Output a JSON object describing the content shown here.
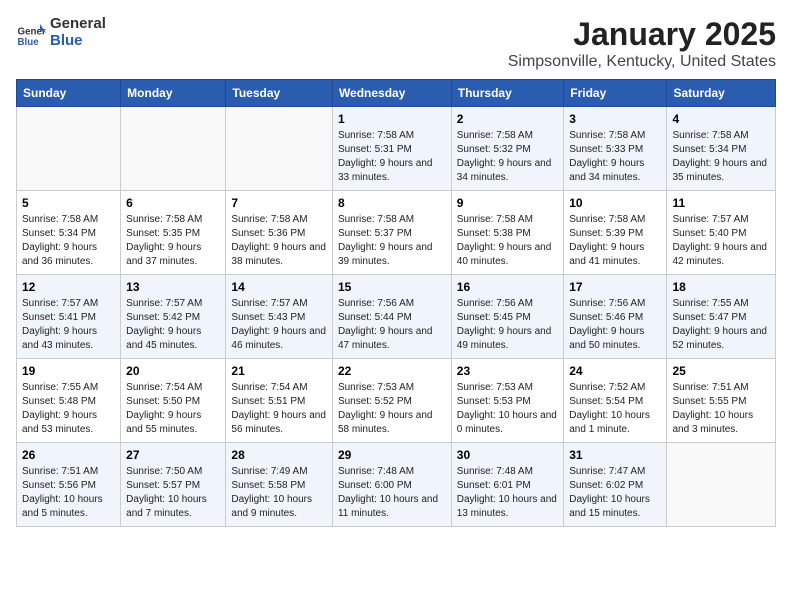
{
  "logo": {
    "name_general": "General",
    "name_blue": "Blue"
  },
  "header": {
    "title": "January 2025",
    "subtitle": "Simpsonville, Kentucky, United States"
  },
  "weekdays": [
    "Sunday",
    "Monday",
    "Tuesday",
    "Wednesday",
    "Thursday",
    "Friday",
    "Saturday"
  ],
  "weeks": [
    [
      {
        "day": "",
        "sunrise": "",
        "sunset": "",
        "daylight": ""
      },
      {
        "day": "",
        "sunrise": "",
        "sunset": "",
        "daylight": ""
      },
      {
        "day": "",
        "sunrise": "",
        "sunset": "",
        "daylight": ""
      },
      {
        "day": "1",
        "sunrise": "Sunrise: 7:58 AM",
        "sunset": "Sunset: 5:31 PM",
        "daylight": "Daylight: 9 hours and 33 minutes."
      },
      {
        "day": "2",
        "sunrise": "Sunrise: 7:58 AM",
        "sunset": "Sunset: 5:32 PM",
        "daylight": "Daylight: 9 hours and 34 minutes."
      },
      {
        "day": "3",
        "sunrise": "Sunrise: 7:58 AM",
        "sunset": "Sunset: 5:33 PM",
        "daylight": "Daylight: 9 hours and 34 minutes."
      },
      {
        "day": "4",
        "sunrise": "Sunrise: 7:58 AM",
        "sunset": "Sunset: 5:34 PM",
        "daylight": "Daylight: 9 hours and 35 minutes."
      }
    ],
    [
      {
        "day": "5",
        "sunrise": "Sunrise: 7:58 AM",
        "sunset": "Sunset: 5:34 PM",
        "daylight": "Daylight: 9 hours and 36 minutes."
      },
      {
        "day": "6",
        "sunrise": "Sunrise: 7:58 AM",
        "sunset": "Sunset: 5:35 PM",
        "daylight": "Daylight: 9 hours and 37 minutes."
      },
      {
        "day": "7",
        "sunrise": "Sunrise: 7:58 AM",
        "sunset": "Sunset: 5:36 PM",
        "daylight": "Daylight: 9 hours and 38 minutes."
      },
      {
        "day": "8",
        "sunrise": "Sunrise: 7:58 AM",
        "sunset": "Sunset: 5:37 PM",
        "daylight": "Daylight: 9 hours and 39 minutes."
      },
      {
        "day": "9",
        "sunrise": "Sunrise: 7:58 AM",
        "sunset": "Sunset: 5:38 PM",
        "daylight": "Daylight: 9 hours and 40 minutes."
      },
      {
        "day": "10",
        "sunrise": "Sunrise: 7:58 AM",
        "sunset": "Sunset: 5:39 PM",
        "daylight": "Daylight: 9 hours and 41 minutes."
      },
      {
        "day": "11",
        "sunrise": "Sunrise: 7:57 AM",
        "sunset": "Sunset: 5:40 PM",
        "daylight": "Daylight: 9 hours and 42 minutes."
      }
    ],
    [
      {
        "day": "12",
        "sunrise": "Sunrise: 7:57 AM",
        "sunset": "Sunset: 5:41 PM",
        "daylight": "Daylight: 9 hours and 43 minutes."
      },
      {
        "day": "13",
        "sunrise": "Sunrise: 7:57 AM",
        "sunset": "Sunset: 5:42 PM",
        "daylight": "Daylight: 9 hours and 45 minutes."
      },
      {
        "day": "14",
        "sunrise": "Sunrise: 7:57 AM",
        "sunset": "Sunset: 5:43 PM",
        "daylight": "Daylight: 9 hours and 46 minutes."
      },
      {
        "day": "15",
        "sunrise": "Sunrise: 7:56 AM",
        "sunset": "Sunset: 5:44 PM",
        "daylight": "Daylight: 9 hours and 47 minutes."
      },
      {
        "day": "16",
        "sunrise": "Sunrise: 7:56 AM",
        "sunset": "Sunset: 5:45 PM",
        "daylight": "Daylight: 9 hours and 49 minutes."
      },
      {
        "day": "17",
        "sunrise": "Sunrise: 7:56 AM",
        "sunset": "Sunset: 5:46 PM",
        "daylight": "Daylight: 9 hours and 50 minutes."
      },
      {
        "day": "18",
        "sunrise": "Sunrise: 7:55 AM",
        "sunset": "Sunset: 5:47 PM",
        "daylight": "Daylight: 9 hours and 52 minutes."
      }
    ],
    [
      {
        "day": "19",
        "sunrise": "Sunrise: 7:55 AM",
        "sunset": "Sunset: 5:48 PM",
        "daylight": "Daylight: 9 hours and 53 minutes."
      },
      {
        "day": "20",
        "sunrise": "Sunrise: 7:54 AM",
        "sunset": "Sunset: 5:50 PM",
        "daylight": "Daylight: 9 hours and 55 minutes."
      },
      {
        "day": "21",
        "sunrise": "Sunrise: 7:54 AM",
        "sunset": "Sunset: 5:51 PM",
        "daylight": "Daylight: 9 hours and 56 minutes."
      },
      {
        "day": "22",
        "sunrise": "Sunrise: 7:53 AM",
        "sunset": "Sunset: 5:52 PM",
        "daylight": "Daylight: 9 hours and 58 minutes."
      },
      {
        "day": "23",
        "sunrise": "Sunrise: 7:53 AM",
        "sunset": "Sunset: 5:53 PM",
        "daylight": "Daylight: 10 hours and 0 minutes."
      },
      {
        "day": "24",
        "sunrise": "Sunrise: 7:52 AM",
        "sunset": "Sunset: 5:54 PM",
        "daylight": "Daylight: 10 hours and 1 minute."
      },
      {
        "day": "25",
        "sunrise": "Sunrise: 7:51 AM",
        "sunset": "Sunset: 5:55 PM",
        "daylight": "Daylight: 10 hours and 3 minutes."
      }
    ],
    [
      {
        "day": "26",
        "sunrise": "Sunrise: 7:51 AM",
        "sunset": "Sunset: 5:56 PM",
        "daylight": "Daylight: 10 hours and 5 minutes."
      },
      {
        "day": "27",
        "sunrise": "Sunrise: 7:50 AM",
        "sunset": "Sunset: 5:57 PM",
        "daylight": "Daylight: 10 hours and 7 minutes."
      },
      {
        "day": "28",
        "sunrise": "Sunrise: 7:49 AM",
        "sunset": "Sunset: 5:58 PM",
        "daylight": "Daylight: 10 hours and 9 minutes."
      },
      {
        "day": "29",
        "sunrise": "Sunrise: 7:48 AM",
        "sunset": "Sunset: 6:00 PM",
        "daylight": "Daylight: 10 hours and 11 minutes."
      },
      {
        "day": "30",
        "sunrise": "Sunrise: 7:48 AM",
        "sunset": "Sunset: 6:01 PM",
        "daylight": "Daylight: 10 hours and 13 minutes."
      },
      {
        "day": "31",
        "sunrise": "Sunrise: 7:47 AM",
        "sunset": "Sunset: 6:02 PM",
        "daylight": "Daylight: 10 hours and 15 minutes."
      },
      {
        "day": "",
        "sunrise": "",
        "sunset": "",
        "daylight": ""
      }
    ]
  ]
}
